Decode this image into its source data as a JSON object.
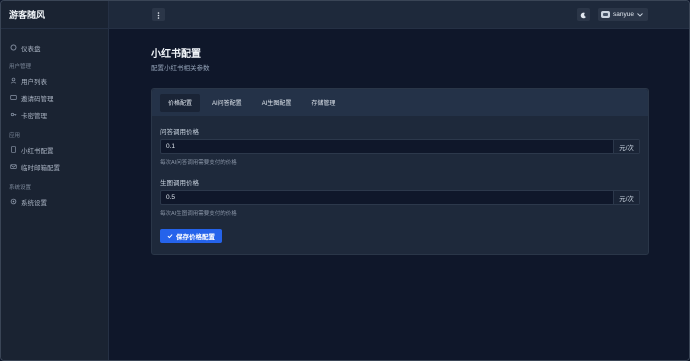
{
  "app": {
    "brand": "游客随风"
  },
  "sidebar": {
    "items": [
      {
        "label": "仪表盘",
        "icon": "dashboard-icon"
      }
    ],
    "groups": [
      {
        "title": "用户管理",
        "items": [
          {
            "label": "用户列表",
            "icon": "users-icon"
          },
          {
            "label": "邀请码管理",
            "icon": "invite-code-icon"
          },
          {
            "label": "卡密管理",
            "icon": "card-key-icon"
          }
        ]
      },
      {
        "title": "应用",
        "items": [
          {
            "label": "小红书配置",
            "icon": "notebook-icon"
          },
          {
            "label": "临时邮箱配置",
            "icon": "mail-icon"
          }
        ]
      },
      {
        "title": "系统设置",
        "items": [
          {
            "label": "系统设置",
            "icon": "settings-icon"
          }
        ]
      }
    ]
  },
  "topbar": {
    "username": "sanyue"
  },
  "page": {
    "title": "小红书配置",
    "subtitle": "配置小红书相关参数"
  },
  "tabs": [
    {
      "label": "价格配置",
      "active": true
    },
    {
      "label": "AI问答配置",
      "active": false
    },
    {
      "label": "AI生图配置",
      "active": false
    },
    {
      "label": "存储管理",
      "active": false
    }
  ],
  "form": {
    "qa_price": {
      "label": "问答调用价格",
      "value": "0.1",
      "unit": "元/次",
      "hint": "每次AI问答调用需要支付的价格"
    },
    "image_price": {
      "label": "生图调用价格",
      "value": "0.5",
      "unit": "元/次",
      "hint": "每次AI生图调用需要支付的价格"
    },
    "save_label": "保存价格配置"
  },
  "colors": {
    "accent": "#2563eb",
    "background": "#0f172a",
    "panel": "#1e293b"
  }
}
